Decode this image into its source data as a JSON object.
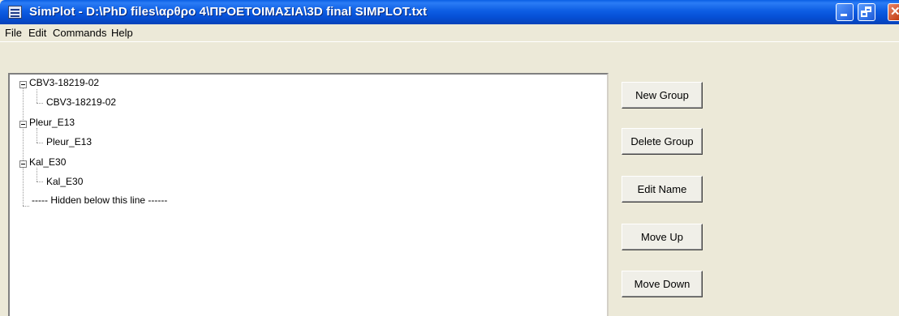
{
  "window": {
    "title": "SimPlot - D:\\PhD files\\αρθρο 4\\ΠΡΟΕΤΟΙΜΑΣΙΑ\\3D final SIMPLOT.txt",
    "controls": [
      "minimize-icon",
      "restore-icon",
      "close-icon"
    ]
  },
  "menu": {
    "file": "File",
    "edit": "Edit",
    "commands": "Commands",
    "help": "Help"
  },
  "tree": {
    "groups": [
      {
        "name": "CBV3-18219-02",
        "child": "CBV3-18219-02"
      },
      {
        "name": "Pleur_E13",
        "child": "Pleur_E13"
      },
      {
        "name": "Kal_E30",
        "child": "Kal_E30"
      }
    ],
    "hidden_line": "----- Hidden below this line ------"
  },
  "buttons": {
    "new_group": "New Group",
    "delete_group": "Delete Group",
    "edit_name": "Edit Name",
    "move_up": "Move Up",
    "move_down": "Move Down"
  }
}
